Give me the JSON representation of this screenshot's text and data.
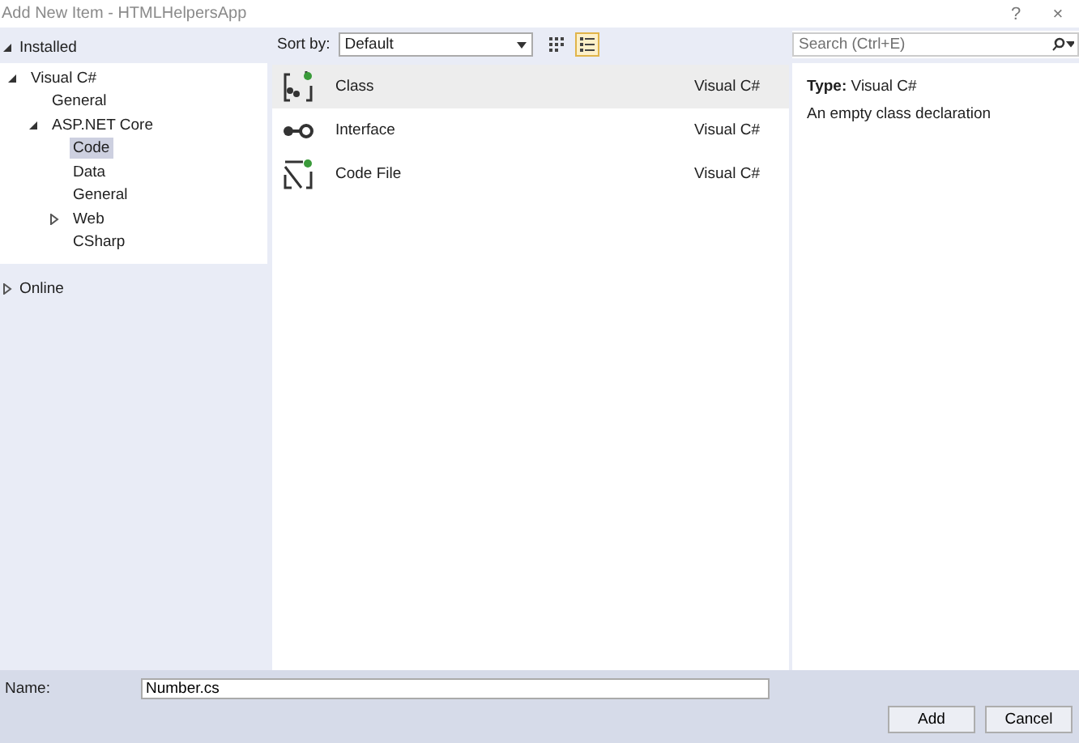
{
  "window": {
    "title": "Add New Item - HTMLHelpersApp",
    "buttons": [
      "?",
      "×"
    ]
  },
  "tree": [
    {
      "label": "Installed",
      "expanded": true,
      "selected": false,
      "children": [
        {
          "label": "Visual C#",
          "expanded": true,
          "selected": false,
          "children": [
            {
              "label": "General",
              "selected": false
            },
            {
              "label": "ASP.NET Core",
              "expanded": true,
              "selected": false,
              "children": [
                {
                  "label": "Code",
                  "selected": true
                },
                {
                  "label": "Data",
                  "selected": false
                },
                {
                  "label": "General",
                  "selected": false
                },
                {
                  "label": "Web",
                  "expanded": false,
                  "selected": false
                },
                {
                  "label": "CSharp",
                  "selected": false
                }
              ]
            }
          ]
        }
      ]
    },
    {
      "label": "Online",
      "expanded": false,
      "selected": false
    }
  ],
  "toolbar": {
    "sort_label": "Sort by:",
    "sort_value": "Default",
    "views": [
      {
        "kind": "grid",
        "selected": false
      },
      {
        "kind": "list",
        "selected": true
      }
    ]
  },
  "items": [
    {
      "kind": "class",
      "name": "Class",
      "type": "Visual C#",
      "selected": true
    },
    {
      "kind": "interface",
      "name": "Interface",
      "type": "Visual C#",
      "selected": false
    },
    {
      "kind": "file",
      "name": "Code File",
      "type": "Visual C#",
      "selected": false
    }
  ],
  "search": {
    "placeholder": "Search (Ctrl+E)"
  },
  "details": {
    "type_label": "Type:",
    "type_value": "Visual C#",
    "description": "An empty class declaration"
  },
  "name_field": {
    "label": "Name:",
    "value": "Number.cs"
  },
  "buttons": [
    "Add",
    "Cancel"
  ]
}
